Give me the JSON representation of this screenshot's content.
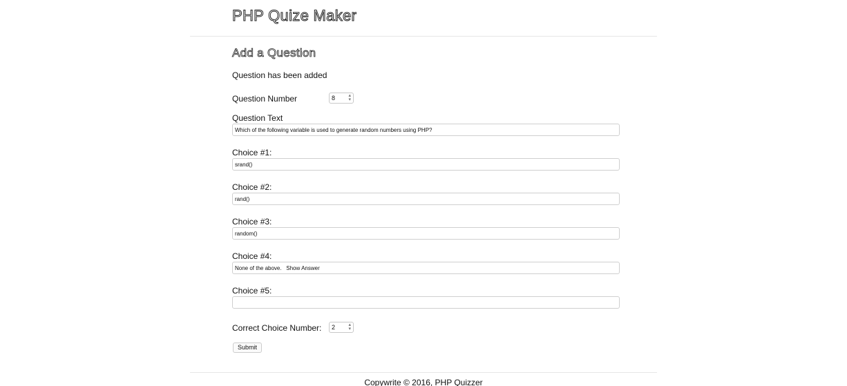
{
  "header": {
    "title": "PHP Quize Maker"
  },
  "form": {
    "heading": "Add a Question",
    "status_message": "Question has been added",
    "question_number": {
      "label": "Question Number",
      "value": "8"
    },
    "question_text": {
      "label": "Question Text",
      "value": "Which of the following variable is used to generate random numbers using PHP?"
    },
    "choices": [
      {
        "label": "Choice #1:",
        "value": "srand()"
      },
      {
        "label": "Choice #2:",
        "value": "rand()"
      },
      {
        "label": "Choice #3:",
        "value": "random()"
      },
      {
        "label": "Choice #4:",
        "value": "None of the above.   Show Answer"
      },
      {
        "label": "Choice #5:",
        "value": ""
      }
    ],
    "correct_choice": {
      "label": "Correct Choice Number:",
      "value": "2"
    },
    "submit_label": "Submit"
  },
  "footer": {
    "copyright": "Copywrite © 2016, PHP Quizzer"
  }
}
